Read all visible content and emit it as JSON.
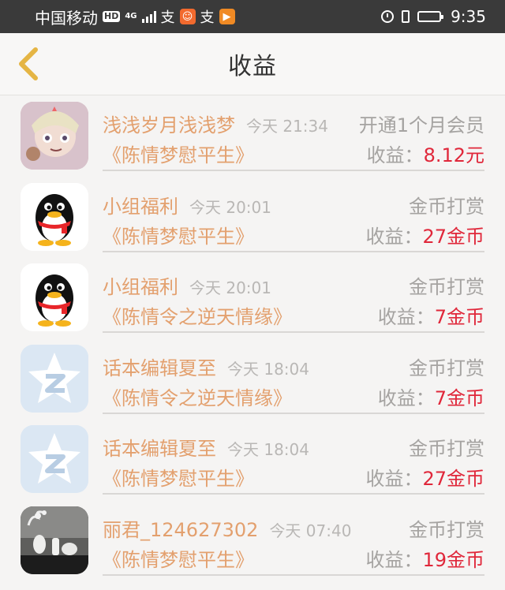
{
  "status_bar": {
    "carrier": "中国移动",
    "hd": "HD",
    "network": "4G",
    "time": "9:35"
  },
  "header": {
    "title": "收益",
    "back_icon": "chevron-left-icon"
  },
  "accent_colors": {
    "name": "#e3a06e",
    "value": "#e0273a",
    "muted": "#a5a3a1"
  },
  "records": [
    {
      "avatar": "cartoon-girl-avatar",
      "name": "浅浅岁月浅浅梦",
      "time": "今天 21:34",
      "type": "开通1个月会员",
      "book": "《陈情梦慰平生》",
      "earn_label": "收益：",
      "earn_value": "8.12元"
    },
    {
      "avatar": "qq-penguin-avatar",
      "name": "小组福利",
      "time": "今天 20:01",
      "type": "金币打赏",
      "book": "《陈情梦慰平生》",
      "earn_label": "收益：",
      "earn_value": "27金币"
    },
    {
      "avatar": "qq-penguin-avatar",
      "name": "小组福利",
      "time": "今天 20:01",
      "type": "金币打赏",
      "book": "《陈情令之逆天情缘》",
      "earn_label": "收益：",
      "earn_value": "7金币"
    },
    {
      "avatar": "qzone-star-avatar",
      "name": "话本编辑夏至",
      "time": "今天 18:04",
      "type": "金币打赏",
      "book": "《陈情令之逆天情缘》",
      "earn_label": "收益：",
      "earn_value": "7金币"
    },
    {
      "avatar": "qzone-star-avatar",
      "name": "话本编辑夏至",
      "time": "今天 18:04",
      "type": "金币打赏",
      "book": "《陈情梦慰平生》",
      "earn_label": "收益：",
      "earn_value": "27金币"
    },
    {
      "avatar": "vase-photo-avatar",
      "name": "丽君_124627302",
      "time": "今天 07:40",
      "type": "金币打赏",
      "book": "《陈情梦慰平生》",
      "earn_label": "收益：",
      "earn_value": "19金币"
    }
  ]
}
